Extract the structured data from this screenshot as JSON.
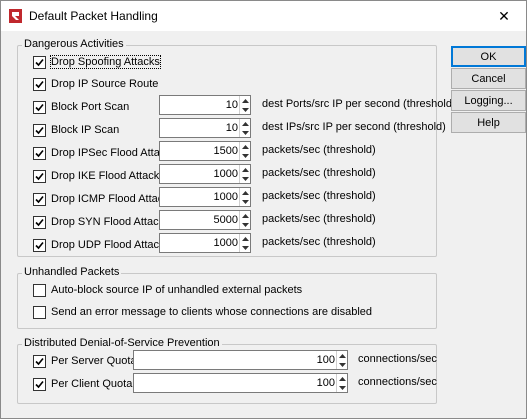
{
  "window": {
    "title": "Default Packet Handling",
    "close_glyph": "✕"
  },
  "dangerous": {
    "title": "Dangerous Activities",
    "items": [
      {
        "label": "Drop Spoofing Attacks",
        "checked": true
      },
      {
        "label": "Drop IP Source Route",
        "checked": true
      },
      {
        "label": "Block Port Scan",
        "checked": true,
        "value": "10",
        "unit": "dest Ports/src IP per second (threshold)"
      },
      {
        "label": "Block IP Scan",
        "checked": true,
        "value": "10",
        "unit": "dest IPs/src IP per second (threshold)"
      },
      {
        "label": "Drop IPSec Flood Attack",
        "checked": true,
        "value": "1500",
        "unit": "packets/sec (threshold)"
      },
      {
        "label": "Drop IKE Flood Attack",
        "checked": true,
        "value": "1000",
        "unit": "packets/sec (threshold)"
      },
      {
        "label": "Drop ICMP Flood Attack",
        "checked": true,
        "value": "1000",
        "unit": "packets/sec (threshold)"
      },
      {
        "label": "Drop SYN Flood Attack",
        "checked": true,
        "value": "5000",
        "unit": "packets/sec (threshold)"
      },
      {
        "label": "Drop UDP Flood Attack",
        "checked": true,
        "value": "1000",
        "unit": "packets/sec (threshold)"
      }
    ]
  },
  "unhandled": {
    "title": "Unhandled Packets",
    "items": [
      {
        "label": "Auto-block source IP of unhandled external packets",
        "checked": false
      },
      {
        "label": "Send an error message to clients whose connections are disabled",
        "checked": false
      }
    ]
  },
  "ddos": {
    "title": "Distributed Denial-of-Service Prevention",
    "items": [
      {
        "label": "Per Server Quota",
        "checked": true,
        "value": "100",
        "unit": "connections/sec"
      },
      {
        "label": "Per Client Quota",
        "checked": true,
        "value": "100",
        "unit": "connections/sec"
      }
    ]
  },
  "buttons": {
    "ok": "OK",
    "cancel": "Cancel",
    "logging": "Logging...",
    "help": "Help"
  },
  "colors": {
    "accent": "#0078d7",
    "window_bg": "#f0f0f0",
    "group_border": "#c8c8c8"
  }
}
